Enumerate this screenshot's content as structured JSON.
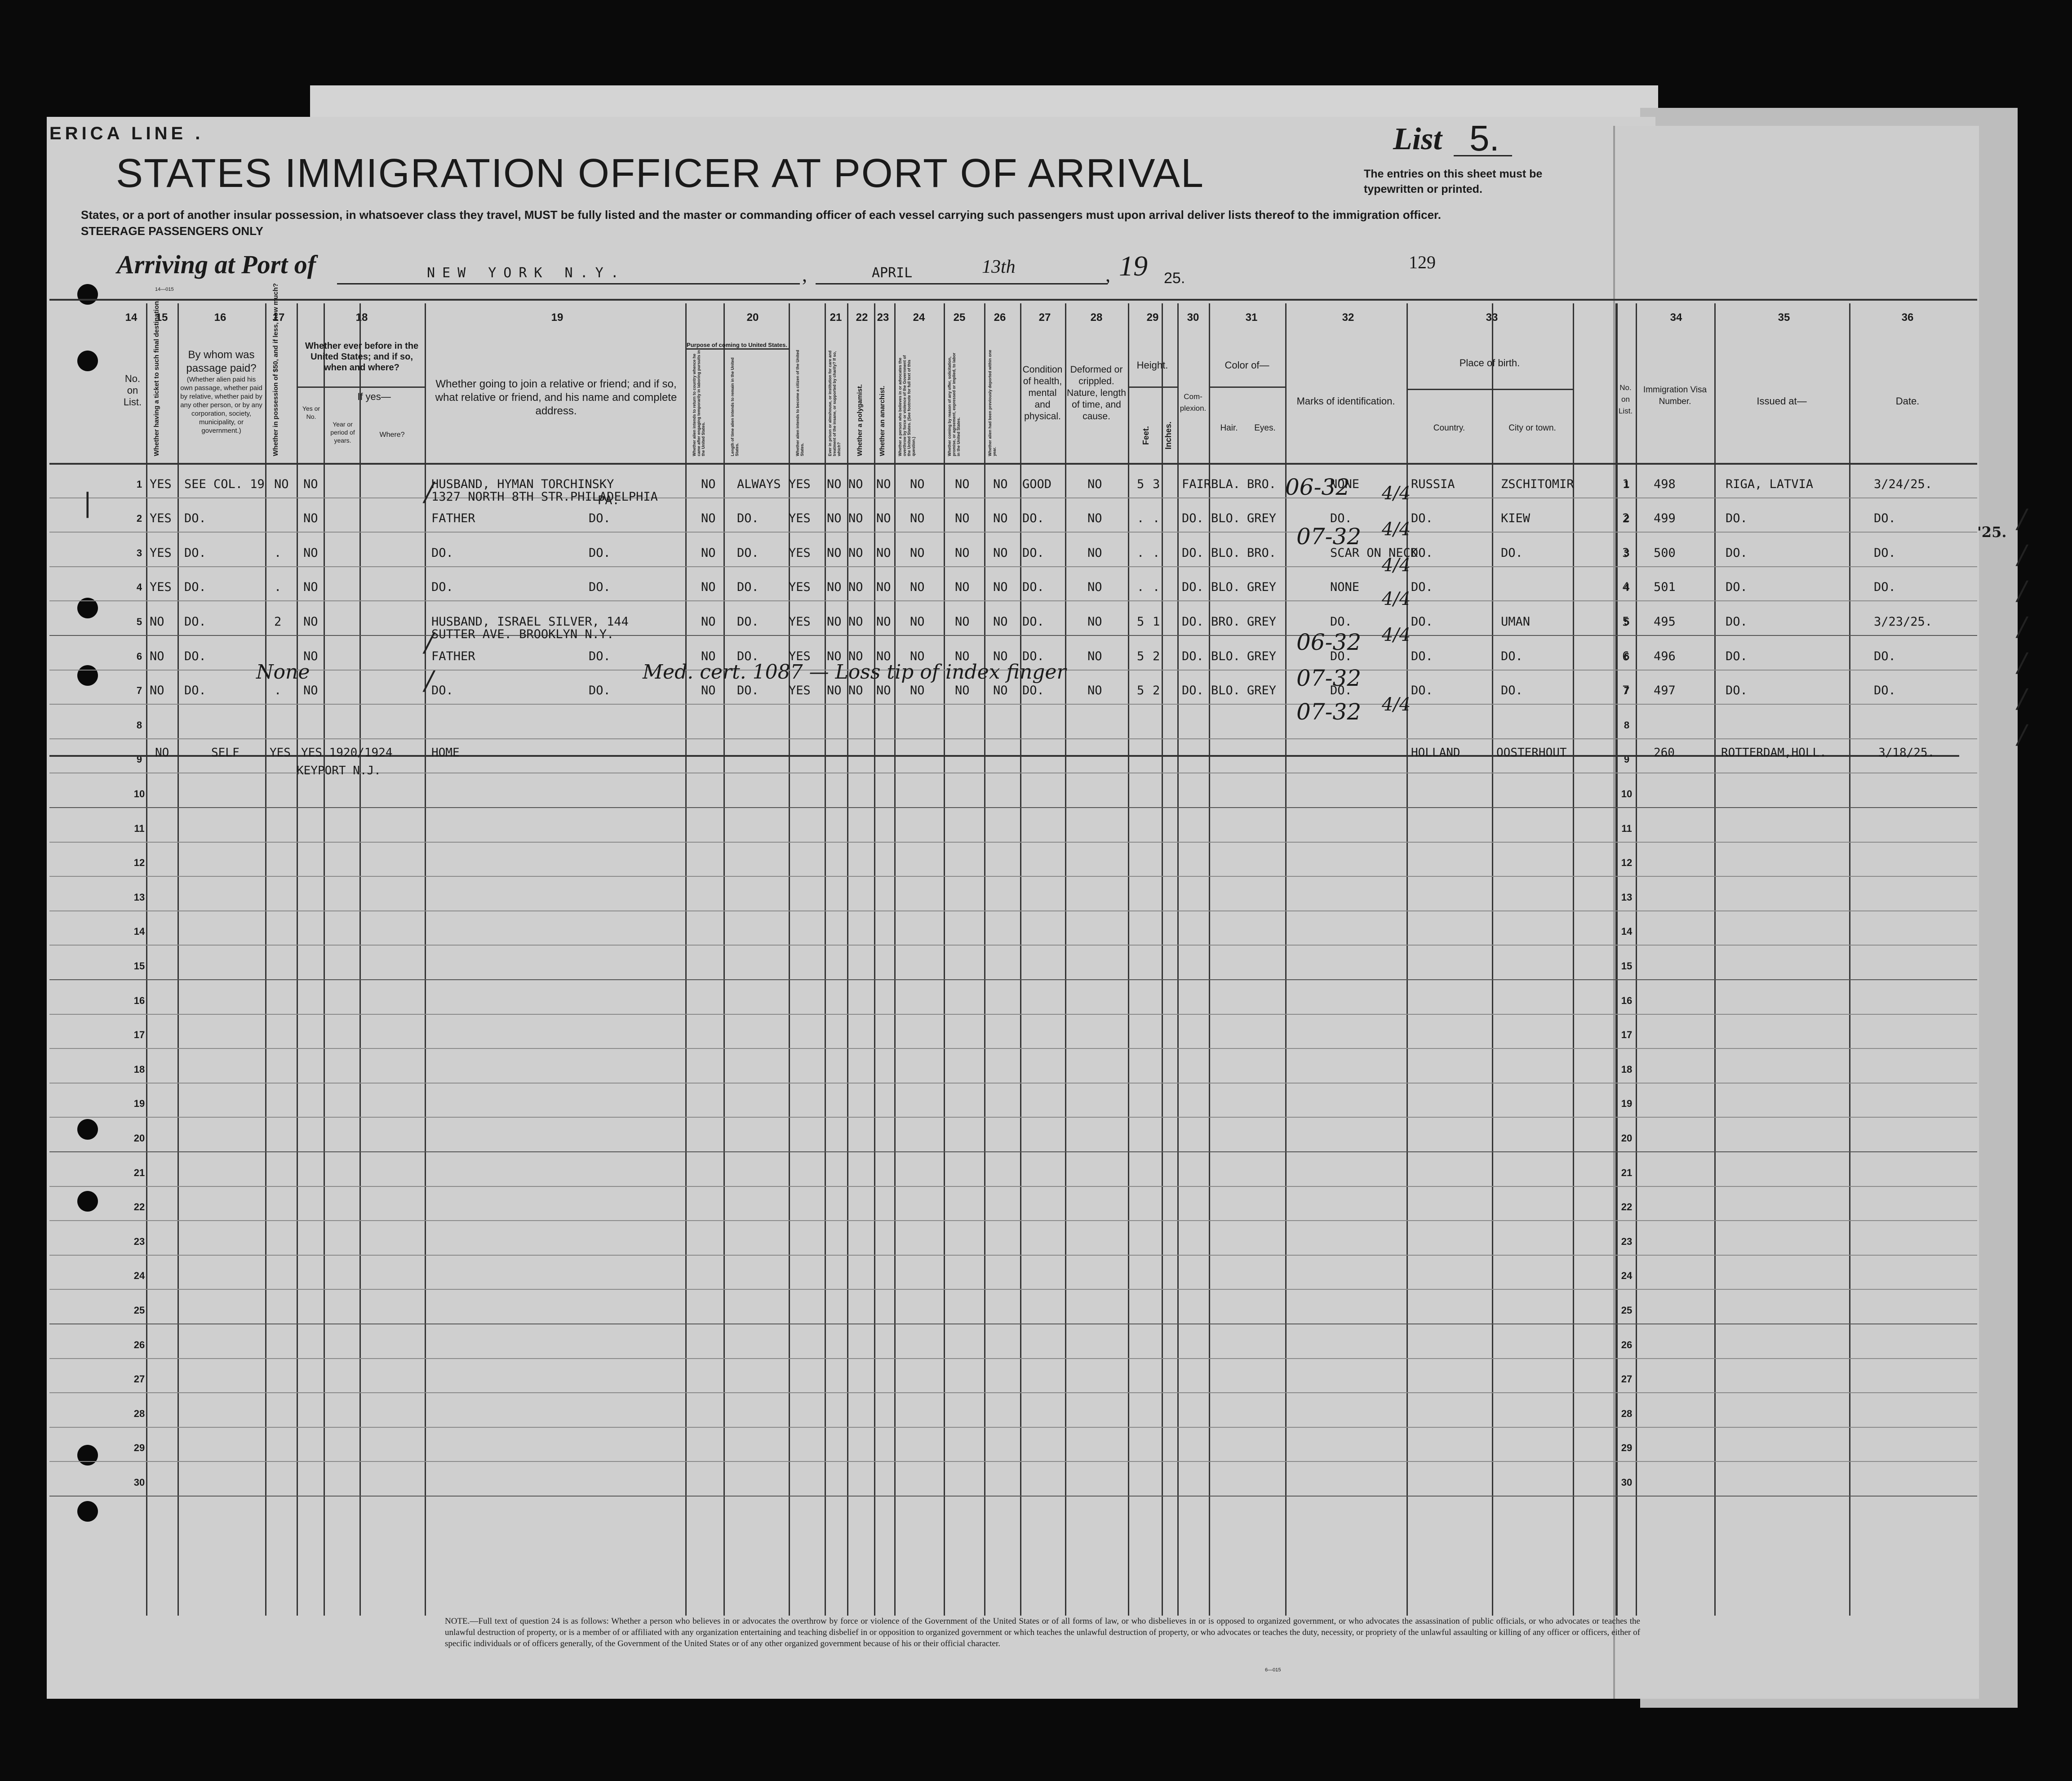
{
  "header": {
    "line_name": "ERICA LINE .",
    "title": "STATES IMMIGRATION OFFICER AT PORT OF ARRIVAL",
    "list_label": "List",
    "list_number": "5.",
    "entries_note": "The entries on this sheet must be typewritten or printed.",
    "instructions": "States, or a port of another insular possession, in whatsoever class they travel, MUST be fully listed and the master or commanding officer of each vessel carrying such passengers must upon arrival deliver lists thereof to the immigration officer.",
    "steerage": "STEERAGE PASSENGERS ONLY",
    "arriving_label": "Arriving at Port of",
    "port": "NEW YORK N.Y.",
    "month": "APRIL",
    "day": "13th",
    "year_prefix": "19",
    "year_suffix": "25.",
    "sheet_number": "129",
    "form_code": "14—015"
  },
  "column_numbers": [
    "14",
    "15",
    "16",
    "17",
    "18",
    "19",
    "20",
    "21",
    "22",
    "23",
    "24",
    "25",
    "26",
    "27",
    "28",
    "29",
    "30",
    "31",
    "32",
    "33",
    "34",
    "35",
    "36"
  ],
  "column_headers": {
    "c14": "No. on List.",
    "c15": "Whether having a ticket to such final destination.",
    "c16_main": "By whom was passage paid?",
    "c16_sub": "(Whether alien paid his own passage, whether paid by relative, whether paid by any other person, or by any corporation, society, municipality, or government.)",
    "c17": "Whether in possession of $50, and if less, how much?",
    "c18_main": "Whether ever before in the United States; and if so, when and where?",
    "c18_yes": "If yes—",
    "c18_yesno": "Yes or No.",
    "c18_year": "Year or period of years.",
    "c18_where": "Where?",
    "c19": "Whether going to join a relative or friend; and if so, what relative or friend, and his name and complete address.",
    "c20_main": "Purpose of coming to United States.",
    "c20_a": "Whether alien intends to return to country whence he came after engaging temporarily in laboring pursuits in the United States.",
    "c20_b": "Length of time alien intends to remain in the United States.",
    "c20_c": "Whether alien intends to become a citizen of the United States.",
    "c21": "Ever in prison or almshouse, or institution for care and treatment of the insane, or supported by charity? If so, which?",
    "c22": "Whether a polygamist.",
    "c23": "Whether an anarchist.",
    "c24": "Whether a person who believes in or advocates the overthrow by force or violence of the Government of the United States. (See footnote for full text of this question.)",
    "c25": "Whether coming by reason of any offer, solicitation, promise, or agreement, expressed or implied, to labor in the United States.",
    "c26": "Whether alien had been previously deported within one year.",
    "c27": "Condition of health, mental and physical.",
    "c28": "Deformed or crippled. Nature, length of time, and cause.",
    "c29_main": "Height.",
    "c29_feet": "Feet.",
    "c29_inches": "Inches.",
    "c30": "Com-plexion.",
    "c31_main": "Color of—",
    "c31_hair": "Hair.",
    "c31_eyes": "Eyes.",
    "c32": "Marks of identification.",
    "c33_main": "Place of birth.",
    "c33_country": "Country.",
    "c33_city": "City or town.",
    "r_no": "No. on List.",
    "c34": "Immigration Visa Number.",
    "c35": "Issued at—",
    "c36": "Date."
  },
  "rows": [
    {
      "no": "1",
      "ticket": "YES",
      "paid": "SEE COL. 19",
      "money": "NO",
      "before": "NO",
      "relative": "HUSBAND, HYMAN TORCHINSKY",
      "relative2": "1327 NORTH 8TH STR.PHILADELPHIA",
      "relative3": "PA.",
      "relative_right": "",
      "return": "NO",
      "length": "ALWAYS",
      "citizen": "YES",
      "prison": "NO",
      "polygamist": "NO",
      "anarchist": "NO",
      "overthrow": "NO",
      "offer": "NO",
      "deported": "NO",
      "health": "GOOD",
      "deformed": "NO",
      "feet": "5",
      "inches": "3",
      "complexion": "FAIR",
      "hair": "BLA.",
      "eyes": "BRO.",
      "marks": "NONE",
      "country": "RUSSIA",
      "city": "ZSCHITOMIR",
      "r_no": "1",
      "visa": "498",
      "issued": "RIGA, LATVIA",
      "date": "3/24/25."
    },
    {
      "no": "2",
      "ticket": "YES",
      "paid": "DO.",
      "money": "",
      "before": "NO",
      "relative": "FATHER",
      "relative2": "",
      "relative3": "",
      "relative_right": "DO.",
      "return": "NO",
      "length": "DO.",
      "citizen": "YES",
      "prison": "NO",
      "polygamist": "NO",
      "anarchist": "NO",
      "overthrow": "NO",
      "offer": "NO",
      "deported": "NO",
      "health": "DO.",
      "deformed": "NO",
      "feet": ".",
      "inches": ".",
      "complexion": "DO.",
      "hair": "BLO.",
      "eyes": "GREY",
      "marks": "DO.",
      "country": "DO.",
      "city": "KIEW",
      "r_no": "2",
      "visa": "499",
      "issued": "DO.",
      "date": "DO."
    },
    {
      "no": "3",
      "ticket": "YES",
      "paid": "DO.",
      "money": ".",
      "before": "NO",
      "relative": "DO.",
      "relative2": "",
      "relative3": "",
      "relative_right": "DO.",
      "return": "NO",
      "length": "DO.",
      "citizen": "YES",
      "prison": "NO",
      "polygamist": "NO",
      "anarchist": "NO",
      "overthrow": "NO",
      "offer": "NO",
      "deported": "NO",
      "health": "DO.",
      "deformed": "NO",
      "feet": ".",
      "inches": ".",
      "complexion": "DO.",
      "hair": "BLO.",
      "eyes": "BRO.",
      "marks": "SCAR ON NECK",
      "country": "DO.",
      "city": "DO.",
      "r_no": "3",
      "visa": "500",
      "issued": "DO.",
      "date": "DO."
    },
    {
      "no": "4",
      "ticket": "YES",
      "paid": "DO.",
      "money": ".",
      "before": "NO",
      "relative": "DO.",
      "relative2": "",
      "relative3": "",
      "relative_right": "DO.",
      "return": "NO",
      "length": "DO.",
      "citizen": "YES",
      "prison": "NO",
      "polygamist": "NO",
      "anarchist": "NO",
      "overthrow": "NO",
      "offer": "NO",
      "deported": "NO",
      "health": "DO.",
      "deformed": "NO",
      "feet": ".",
      "inches": ".",
      "complexion": "DO.",
      "hair": "BLO.",
      "eyes": "GREY",
      "marks": "NONE",
      "country": "DO.",
      "city": "",
      "r_no": "4",
      "visa": "501",
      "issued": "DO.",
      "date": "DO."
    },
    {
      "no": "5",
      "ticket": "NO",
      "paid": "DO.",
      "money": "2",
      "before": "NO",
      "relative": "HUSBAND, ISRAEL SILVER, 144",
      "relative2": "SUTTER AVE. BROOKLYN N.Y.",
      "relative3": "",
      "relative_right": "",
      "return": "NO",
      "length": "DO.",
      "citizen": "YES",
      "prison": "NO",
      "polygamist": "NO",
      "anarchist": "NO",
      "overthrow": "NO",
      "offer": "NO",
      "deported": "NO",
      "health": "DO.",
      "deformed": "NO",
      "feet": "5",
      "inches": "1",
      "complexion": "DO.",
      "hair": "BRO.",
      "eyes": "GREY",
      "marks": "DO.",
      "country": "DO.",
      "city": "UMAN",
      "r_no": "5",
      "visa": "495",
      "issued": "DO.",
      "date": "3/23/25."
    },
    {
      "no": "6",
      "ticket": "NO",
      "paid": "DO.",
      "money": "",
      "before": "NO",
      "relative": "FATHER",
      "relative2": "",
      "relative3": "",
      "relative_right": "DO.",
      "return": "NO",
      "length": "DO.",
      "citizen": "YES",
      "prison": "NO",
      "polygamist": "NO",
      "anarchist": "NO",
      "overthrow": "NO",
      "offer": "NO",
      "deported": "NO",
      "health": "DO.",
      "deformed": "NO",
      "feet": "5",
      "inches": "2",
      "complexion": "DO.",
      "hair": "BLO.",
      "eyes": "GREY",
      "marks": "DO.",
      "country": "DO.",
      "city": "DO.",
      "r_no": "6",
      "visa": "496",
      "issued": "DO.",
      "date": "DO."
    },
    {
      "no": "7",
      "ticket": "NO",
      "paid": "DO.",
      "money": ".",
      "before": "NO",
      "relative": "DO.",
      "relative2": "",
      "relative3": "",
      "relative_right": "DO.",
      "return": "NO",
      "length": "DO.",
      "citizen": "YES",
      "prison": "NO",
      "polygamist": "NO",
      "anarchist": "NO",
      "overthrow": "NO",
      "offer": "NO",
      "deported": "NO",
      "health": "DO.",
      "deformed": "NO",
      "feet": "5",
      "inches": "2",
      "complexion": "DO.",
      "hair": "BLO.",
      "eyes": "GREY",
      "marks": "DO.",
      "country": "DO.",
      "city": "DO.",
      "r_no": "7",
      "visa": "497",
      "issued": "DO.",
      "date": "DO."
    }
  ],
  "struck_row": {
    "no": "8",
    "ticket": "NO",
    "paid": "SELF",
    "money": "YES",
    "before": "YES 1920/1924",
    "relative": "HOME",
    "address": "KEYPORT N.J.",
    "country": "HOLLAND",
    "city": "OOSTERHOUT",
    "r_no": "8",
    "visa": "260",
    "issued": "ROTTERDAM,HOLL.",
    "date": "3/18/25."
  },
  "handwriting": {
    "mark_r1": "06-32",
    "mark_r2": "07-32",
    "mark_r5": "06-32",
    "mark_r6": "07-32",
    "mark_r7": "07-32",
    "mark_tail": "4/4",
    "medical_note": "Med. cert. 1087 — Loss tip of index finger",
    "money_note": "None",
    "right_edge": "'25."
  },
  "row_numbers": [
    "1",
    "2",
    "3",
    "4",
    "5",
    "6",
    "7",
    "8",
    "9",
    "10",
    "11",
    "12",
    "13",
    "14",
    "15",
    "16",
    "17",
    "18",
    "19",
    "20",
    "21",
    "22",
    "23",
    "24",
    "25",
    "26",
    "27",
    "28",
    "29",
    "30"
  ],
  "footer": {
    "note": "NOTE.—Full text of question 24 is as follows: Whether a person who believes in or advocates the overthrow by force or violence of the Government of the United States or of all forms of law, or who disbelieves in or is opposed to organized government, or who advocates the assassination of public officials, or who advocates or teaches the unlawful destruction of property, or is a member of or affiliated with any organization entertaining and teaching disbelief in or opposition to organized government or which teaches the unlawful destruction of property, or who advocates or teaches the duty, necessity, or propriety of the unlawful assaulting or killing of any officer or officers, either of specific individuals or of officers generally, of the Government of the United States or of any other organized government because of his or their official character.",
    "form_no": "6—015"
  }
}
